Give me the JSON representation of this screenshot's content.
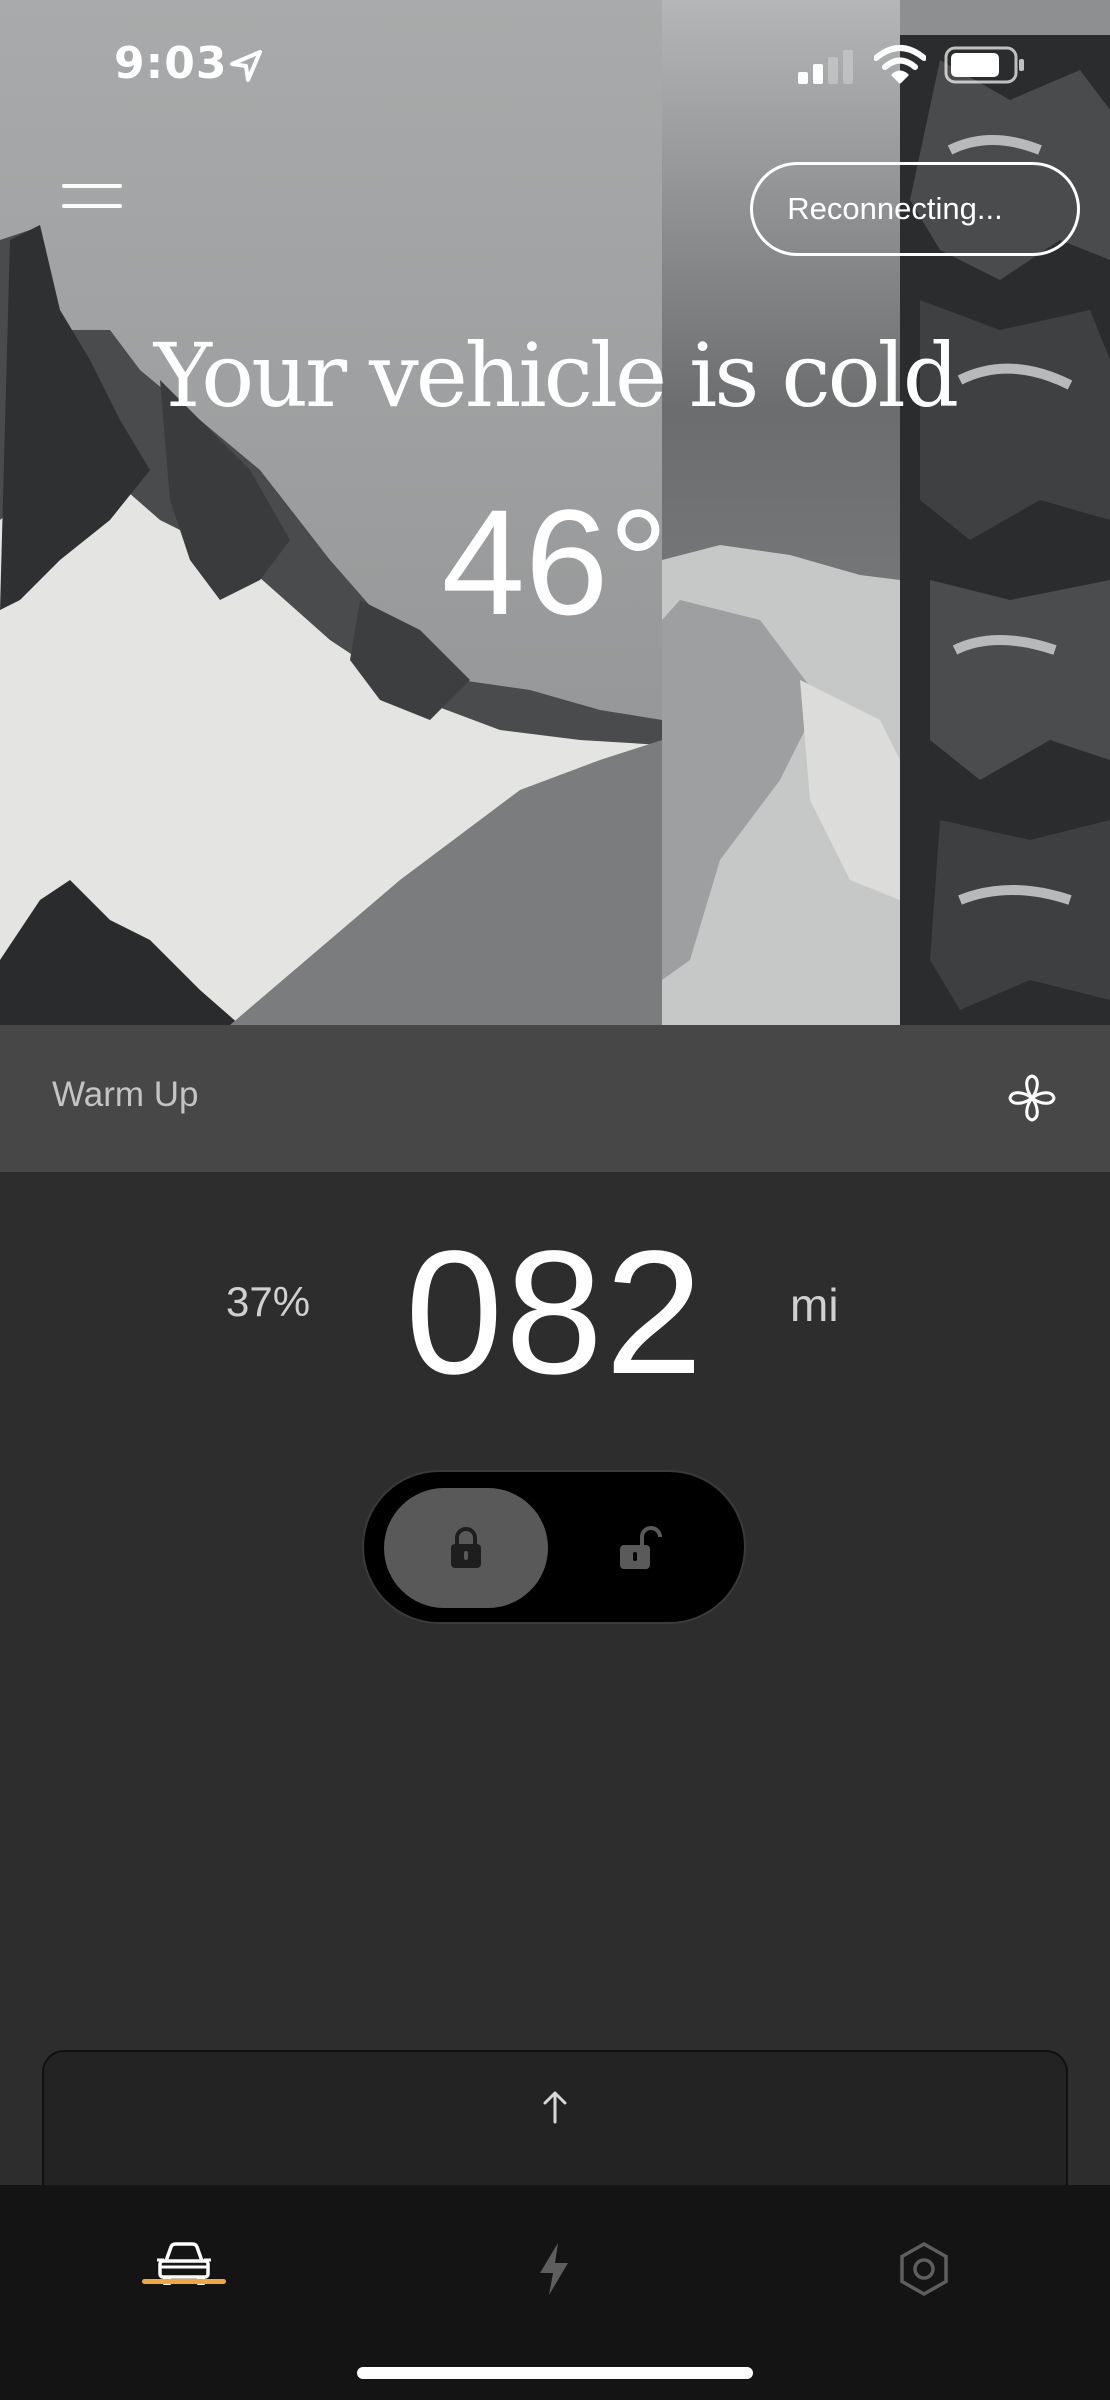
{
  "status_bar": {
    "time": "9:03",
    "icons": [
      "location-arrow-icon",
      "cellular-signal-icon",
      "wifi-icon",
      "battery-icon"
    ]
  },
  "header": {
    "menu_icon": "hamburger-menu-icon",
    "connection_button_label": "Reconnecting..."
  },
  "hero": {
    "title": "Your vehicle is cold",
    "temperature": "46°",
    "background": "monochrome collage of snowy mountains and pine trees"
  },
  "warm_up": {
    "label": "Warm Up",
    "icon": "fan-icon"
  },
  "range": {
    "battery_percent": "37%",
    "value": "082",
    "unit": "mi"
  },
  "lock_toggle": {
    "selected": "locked",
    "options": [
      "lock-closed-icon",
      "lock-open-icon"
    ]
  },
  "drawer": {
    "icon": "arrow-up-icon"
  },
  "tab_bar": {
    "tabs": [
      "car-icon",
      "lightning-bolt-icon",
      "hexagon-settings-icon"
    ],
    "active_tab": "car-icon",
    "accent_color": "#f3a73a"
  },
  "colors": {
    "panel_background": "#2d2d2d",
    "warm_up_strip": "#474747",
    "tab_bar": "#141414"
  }
}
